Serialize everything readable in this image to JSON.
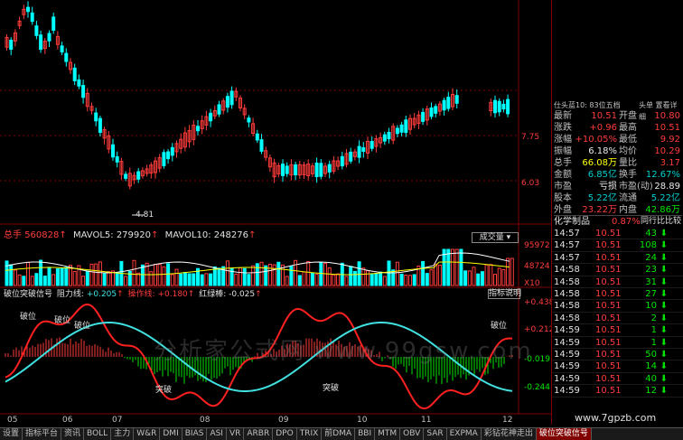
{
  "chart_header": {
    "right_header": "仕头蓝10: 83位五档",
    "right_header2": "头单  置看详细"
  },
  "price_axis": [
    "7.75",
    "6.03"
  ],
  "low_marker": "4.81",
  "volume_header": {
    "total_label": "总手",
    "total_value": "560828",
    "mavol5_label": "MAVOL5:",
    "mavol5_value": "279920",
    "mavol10_label": "MAVOL10:",
    "mavol10_value": "248276",
    "button": "成交量"
  },
  "volume_axis": [
    "95972",
    "48724",
    "X10"
  ],
  "indicator_header": {
    "name": "破位突破信号",
    "l1_label": "阻力线:",
    "l1_value": "+0.205",
    "l2_label": "操作线:",
    "l2_value": "+0.180",
    "l3_label": "红绿棒:",
    "l3_value": "-0.025",
    "button": "指标说明"
  },
  "indicator_axis": [
    "+0.438",
    "+0.212",
    "-0.019",
    "-0.244"
  ],
  "indicator_labels": [
    "破位",
    "破位",
    "破位",
    "突破",
    "突破",
    "破位"
  ],
  "date_labels": [
    "05",
    "06",
    "07",
    "08",
    "09",
    "10",
    "11",
    "12"
  ],
  "quote": {
    "rows": [
      {
        "l1": "最新",
        "v1": "10.51",
        "c1": "red",
        "l2": "开盘",
        "v2": "10.80",
        "c2": "red"
      },
      {
        "l1": "涨跌",
        "v1": "+0.96",
        "c1": "red",
        "l2": "最高",
        "v2": "10.51",
        "c2": "red"
      },
      {
        "l1": "涨幅",
        "v1": "+10.05%",
        "c1": "red",
        "l2": "最低",
        "v2": "9.92",
        "c2": "red"
      },
      {
        "l1": "振幅",
        "v1": "6.18%",
        "c1": "white",
        "l2": "均价",
        "v2": "10.29",
        "c2": "red"
      },
      {
        "l1": "总手",
        "v1": "66.08万",
        "c1": "yellow",
        "l2": "量比",
        "v2": "3.17",
        "c2": "red"
      },
      {
        "l1": "金额",
        "v1": "6.85亿",
        "c1": "cyan",
        "l2": "换手",
        "v2": "12.67%",
        "c2": "cyan"
      },
      {
        "l1": "市盈",
        "v1": "亏损",
        "c1": "white",
        "l2": "市盈(动)",
        "v2": "28.89",
        "c2": "white"
      },
      {
        "l1": "股本",
        "v1": "5.22亿",
        "c1": "cyan",
        "l2": "流通",
        "v2": "5.22亿",
        "c2": "cyan"
      },
      {
        "l1": "外盘",
        "v1": "23.22万",
        "c1": "red",
        "l2": "内盘",
        "v2": "42.86万",
        "c2": "green"
      }
    ],
    "sector": "化学制品",
    "sector_pct": "0.87%",
    "sector_btn": "同行比比较"
  },
  "ticks": [
    {
      "time": "14:57",
      "price": "10.51",
      "vol": "43",
      "dir": "down"
    },
    {
      "time": "14:57",
      "price": "10.51",
      "vol": "108",
      "dir": "down"
    },
    {
      "time": "14:57",
      "price": "10.51",
      "vol": "24",
      "dir": "down"
    },
    {
      "time": "14:58",
      "price": "10.51",
      "vol": "23",
      "dir": "down"
    },
    {
      "time": "14:58",
      "price": "10.51",
      "vol": "31",
      "dir": "down"
    },
    {
      "time": "14:58",
      "price": "10.51",
      "vol": "27",
      "dir": "down"
    },
    {
      "time": "14:58",
      "price": "10.51",
      "vol": "10",
      "dir": "down"
    },
    {
      "time": "14:58",
      "price": "10.51",
      "vol": "2",
      "dir": "down"
    },
    {
      "time": "14:59",
      "price": "10.51",
      "vol": "1",
      "dir": "down"
    },
    {
      "time": "14:59",
      "price": "10.51",
      "vol": "1",
      "dir": "down"
    },
    {
      "time": "14:59",
      "price": "10.51",
      "vol": "50",
      "dir": "down"
    },
    {
      "time": "14:59",
      "price": "10.51",
      "vol": "14",
      "dir": "down"
    },
    {
      "time": "14:59",
      "price": "10.51",
      "vol": "40",
      "dir": "down"
    },
    {
      "time": "14:59",
      "price": "10.51",
      "vol": "12",
      "dir": "down"
    }
  ],
  "tabs": [
    "设置",
    "指标平台",
    "资讯",
    "BOLL",
    "主力",
    "W&R",
    "DMI",
    "BIAS",
    "ASI",
    "VR",
    "ARBR",
    "DPO",
    "TRIX",
    "前DMA",
    "BBI",
    "MTM",
    "OBV",
    "SAR",
    "EXPMA",
    "彩钻花神走出",
    "破位突破信号"
  ],
  "active_tab": "破位突破信号",
  "watermark": "分析家公式网 www.99gsw.com",
  "site": "www.7gpzb.com",
  "colors": {
    "up": "#ff3c3c",
    "down": "#00ffff",
    "grid": "#800000",
    "line_red": "#ff2020",
    "line_cyan": "#40e0e0"
  }
}
